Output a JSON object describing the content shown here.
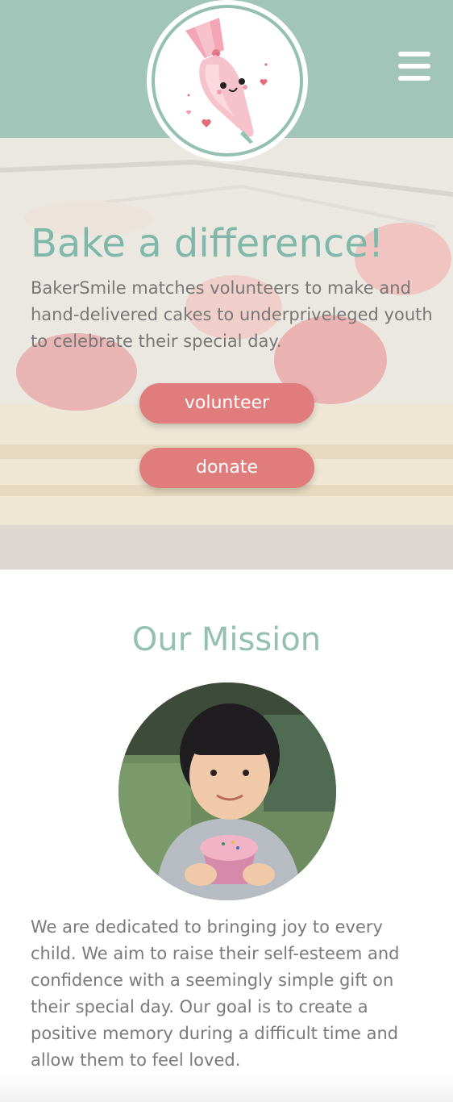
{
  "header": {
    "logo_icon": "piping-bag-mascot-icon",
    "menu_icon": "hamburger-menu-icon",
    "background_color": "#a1c5b8"
  },
  "hero": {
    "title": "Bake a difference!",
    "description": "BakerSmile matches volunteers to make and hand-delivered cakes to underpriveleged youth to celebrate their special day.",
    "volunteer_label": "volunteer",
    "donate_label": "donate",
    "accent_color": "#7fb8aa",
    "button_color": "#e07c7c"
  },
  "mission": {
    "title": "Our Mission",
    "photo": "child-holding-cupcake-photo",
    "text": "We are dedicated to bringing joy to every child. We aim to raise their self-esteem and confidence with a seemingly simple gift on their special day. Our goal is to create a positive memory during a difficult time and allow them to feel loved."
  }
}
